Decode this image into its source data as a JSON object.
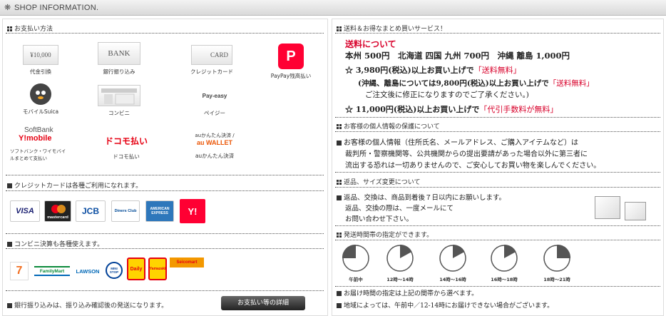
{
  "header": {
    "icon": "❋",
    "title": "SHOP INFORMATION."
  },
  "left": {
    "payment_title": "お支払い方法",
    "payments": [
      {
        "box": "¥10,000",
        "label": "代金引換",
        "icon": "cash-icon"
      },
      {
        "box": "BANK",
        "label": "銀行振り込み",
        "icon": "bank-icon"
      },
      {
        "box": "CARD",
        "label": "クレジットカード",
        "icon": "card-icon"
      },
      {
        "box": "P",
        "label": "PayPay残高払い",
        "icon": "paypay-icon"
      },
      {
        "box": "",
        "label": "モバイルSuica",
        "icon": "suica-icon"
      },
      {
        "box": "",
        "label": "コンビニ",
        "icon": "convenience-store-icon"
      },
      {
        "box": "Pay-easy",
        "label": "ペイジー",
        "icon": "payeasy-icon"
      },
      {
        "box": "SoftBank",
        "box2": "Y!mobile",
        "label": "ソフトバンク・ワイモバイ",
        "label2": "ルまとめて支払い",
        "icon": "softbank-icon"
      },
      {
        "box": "ドコモ払い",
        "label": "ドコモ払い",
        "icon": "docomo-icon"
      },
      {
        "box": "auかんたん決済 /",
        "box2": "au WALLET",
        "label": "auかんたん決済",
        "icon": "au-icon"
      }
    ],
    "credit_title": "クレジットカードは各種ご利用になれます。",
    "cards": [
      {
        "text": "VISA",
        "color": "#1a1f71"
      },
      {
        "text": "mastercard",
        "color": "#eb001b"
      },
      {
        "text": "JCB",
        "color": "#0b4ea2"
      },
      {
        "text": "Diners Club",
        "color": "#004a97"
      },
      {
        "text": "AMERICAN EXPRESS",
        "color": "#2e77bb"
      },
      {
        "text": "Y!",
        "color": "#ff0033"
      }
    ],
    "conv_title": "コンビニ決算も各種使えます。",
    "convs": [
      {
        "text": "7",
        "color": "#f26f21"
      },
      {
        "text": "FamilyMart",
        "color": "#0a8a3a"
      },
      {
        "text": "LAWSON",
        "color": "#0068b7"
      },
      {
        "text": "MINI STOP",
        "color": "#004097"
      },
      {
        "text": "Daily",
        "color": "#e60012"
      },
      {
        "text": "Yamazaki",
        "color": "#e60012"
      },
      {
        "text": "Seicomart",
        "color": "#f39800"
      }
    ],
    "bank_note": "銀行振り込みは、振り込み確認後の発送になります。",
    "detail_button": "お支払い等の詳細"
  },
  "right": {
    "shipping_title": "送料＆お得なまとめ買いサービス！",
    "shipping_heading": "送料について",
    "rates": "本州 500円　北海道 四国 九州 700円　沖縄 離島 1,000円",
    "free1_a": "☆ 3,980円(税込)以上お買い上げで",
    "free1_b": "「送料無料」",
    "okinawa_a": "(沖縄、離島については9,800円(税込)以上お買い上げで",
    "okinawa_b": "「送料無料」",
    "okinawa_c": "ご注文後に修正になりますのでご了承ください。)",
    "free2_a": "☆ 11,000円(税込)以上お買い上げで",
    "free2_b": "「代引手数料が無料」",
    "privacy_title": "お客様の個人情報の保護について",
    "privacy_1": "お客様の個人情報（住所氏名、メールアドレス、ご購入アイテムなど）は",
    "privacy_2": "裁判所・警察機関等、公共機関からの提出要請があった場合以外に第三者に",
    "privacy_3": "流出する恐れは一切ありませんので、ご安心してお買い物を楽しんでください。",
    "return_title": "返品、サイズ変更について",
    "return_1": "返品、交換は、商品到着後７日以内にお願いします。",
    "return_2": "返品、交換の際は、一度メールにて",
    "return_3": "お問い合わせ下さい。",
    "delivery_title": "発送時間帯の指定ができます。",
    "slots": [
      {
        "label": "午前中",
        "fraction": 0.25
      },
      {
        "label": "12時～14時",
        "fraction": 0.17
      },
      {
        "label": "14時～16時",
        "fraction": 0.17
      },
      {
        "label": "16時～18時",
        "fraction": 0.17
      },
      {
        "label": "18時～21時",
        "fraction": 0.25
      }
    ],
    "delivery_note1": "お届け時間の指定は上記の間帯から選べます。",
    "delivery_note2": "地域によっては、午前中／12-14時にお届けできない場合がございます。"
  }
}
